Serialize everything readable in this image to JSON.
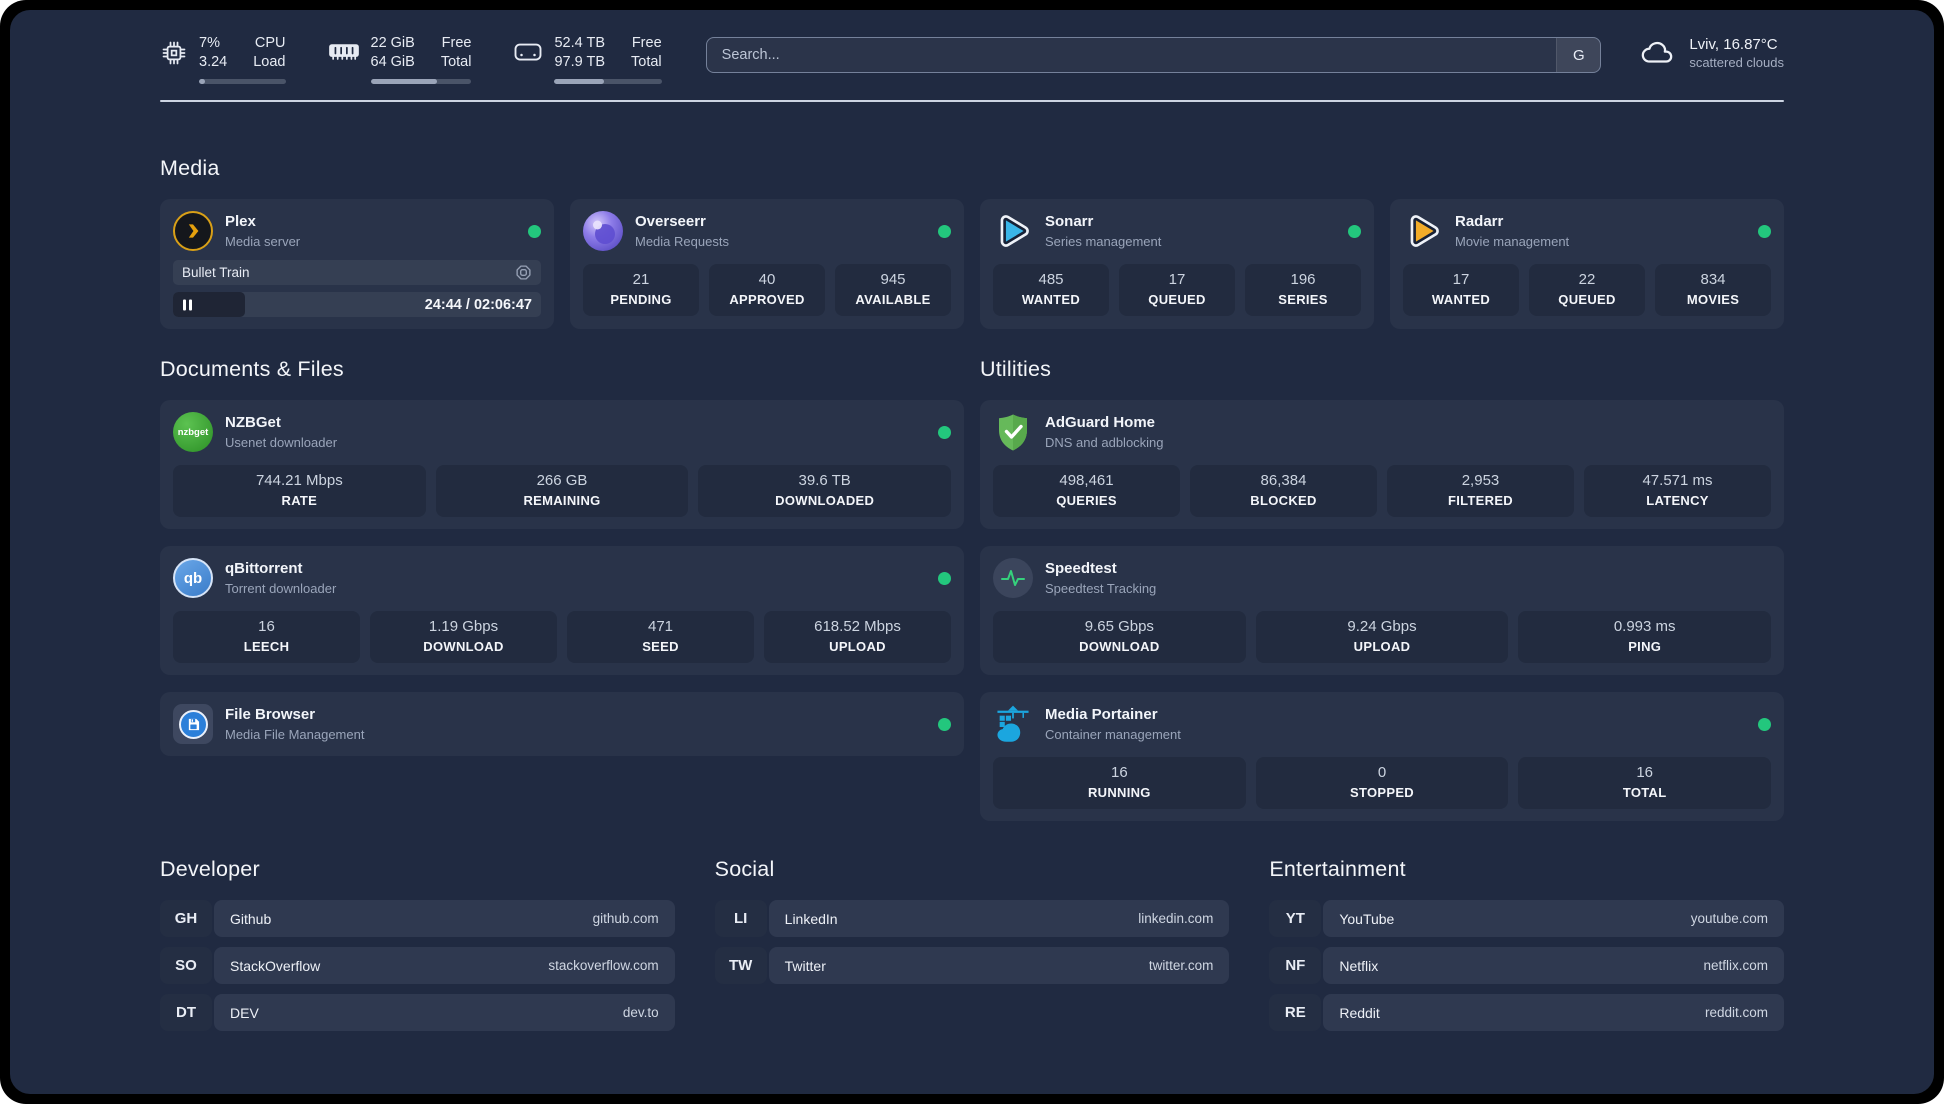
{
  "header": {
    "cpu": {
      "line1_value": "7%",
      "line2_value": "3.24",
      "line1_label": "CPU",
      "line2_label": "Load",
      "progress_pct": 7
    },
    "memory": {
      "line1_value": "22 GiB",
      "line2_value": "64 GiB",
      "line1_label": "Free",
      "line2_label": "Total",
      "progress_pct": 66
    },
    "storage": {
      "line1_value": "52.4 TB",
      "line2_value": "97.9 TB",
      "line1_label": "Free",
      "line2_label": "Total",
      "progress_pct": 46
    },
    "search": {
      "placeholder": "Search...",
      "engine_label": "G"
    },
    "weather": {
      "location_temp": "Lviv, 16.87°C",
      "condition": "scattered clouds"
    }
  },
  "media": {
    "title": "Media",
    "apps": [
      {
        "name": "Plex",
        "subtitle": "Media server",
        "icon": "plex-icon",
        "status": "online",
        "now_playing": {
          "title": "Bullet Train",
          "time": "24:44 / 02:06:47",
          "progress_pct": 19.5
        }
      },
      {
        "name": "Overseerr",
        "subtitle": "Media Requests",
        "icon": "overseerr-icon",
        "status": "online",
        "stats": [
          {
            "value": "21",
            "label": "PENDING"
          },
          {
            "value": "40",
            "label": "APPROVED"
          },
          {
            "value": "945",
            "label": "AVAILABLE"
          }
        ]
      },
      {
        "name": "Sonarr",
        "subtitle": "Series management",
        "icon": "sonarr-icon",
        "status": "online",
        "stats": [
          {
            "value": "485",
            "label": "WANTED"
          },
          {
            "value": "17",
            "label": "QUEUED"
          },
          {
            "value": "196",
            "label": "SERIES"
          }
        ]
      },
      {
        "name": "Radarr",
        "subtitle": "Movie management",
        "icon": "radarr-icon",
        "status": "online",
        "stats": [
          {
            "value": "17",
            "label": "WANTED"
          },
          {
            "value": "22",
            "label": "QUEUED"
          },
          {
            "value": "834",
            "label": "MOVIES"
          }
        ]
      }
    ]
  },
  "documents": {
    "title": "Documents & Files",
    "apps": [
      {
        "name": "NZBGet",
        "subtitle": "Usenet downloader",
        "icon": "nzbget-icon",
        "icon_text": "nzbget",
        "status": "online",
        "stats": [
          {
            "value": "744.21 Mbps",
            "label": "RATE"
          },
          {
            "value": "266 GB",
            "label": "REMAINING"
          },
          {
            "value": "39.6 TB",
            "label": "DOWNLOADED"
          }
        ]
      },
      {
        "name": "qBittorrent",
        "subtitle": "Torrent downloader",
        "icon": "qbittorrent-icon",
        "icon_text": "qb",
        "status": "online",
        "stats": [
          {
            "value": "16",
            "label": "LEECH"
          },
          {
            "value": "1.19 Gbps",
            "label": "DOWNLOAD"
          },
          {
            "value": "471",
            "label": "SEED"
          },
          {
            "value": "618.52 Mbps",
            "label": "UPLOAD"
          }
        ]
      },
      {
        "name": "File Browser",
        "subtitle": "Media File Management",
        "icon": "filebrowser-icon",
        "status": "online",
        "stats": []
      }
    ]
  },
  "utilities": {
    "title": "Utilities",
    "apps": [
      {
        "name": "AdGuard Home",
        "subtitle": "DNS and adblocking",
        "icon": "adguard-icon",
        "stats": [
          {
            "value": "498,461",
            "label": "QUERIES"
          },
          {
            "value": "86,384",
            "label": "BLOCKED"
          },
          {
            "value": "2,953",
            "label": "FILTERED"
          },
          {
            "value": "47.571 ms",
            "label": "LATENCY"
          }
        ]
      },
      {
        "name": "Speedtest",
        "subtitle": "Speedtest Tracking",
        "icon": "speedtest-icon",
        "stats": [
          {
            "value": "9.65 Gbps",
            "label": "DOWNLOAD"
          },
          {
            "value": "9.24 Gbps",
            "label": "UPLOAD"
          },
          {
            "value": "0.993 ms",
            "label": "PING"
          }
        ]
      },
      {
        "name": "Media Portainer",
        "subtitle": "Container management",
        "icon": "portainer-icon",
        "status": "online",
        "stats": [
          {
            "value": "16",
            "label": "RUNNING"
          },
          {
            "value": "0",
            "label": "STOPPED"
          },
          {
            "value": "16",
            "label": "TOTAL"
          }
        ]
      }
    ]
  },
  "links": [
    {
      "title": "Developer",
      "items": [
        {
          "abbr": "GH",
          "name": "Github",
          "url": "github.com"
        },
        {
          "abbr": "SO",
          "name": "StackOverflow",
          "url": "stackoverflow.com"
        },
        {
          "abbr": "DT",
          "name": "DEV",
          "url": "dev.to"
        }
      ]
    },
    {
      "title": "Social",
      "items": [
        {
          "abbr": "LI",
          "name": "LinkedIn",
          "url": "linkedin.com"
        },
        {
          "abbr": "TW",
          "name": "Twitter",
          "url": "twitter.com"
        }
      ]
    },
    {
      "title": "Entertainment",
      "items": [
        {
          "abbr": "YT",
          "name": "YouTube",
          "url": "youtube.com"
        },
        {
          "abbr": "NF",
          "name": "Netflix",
          "url": "netflix.com"
        },
        {
          "abbr": "RE",
          "name": "Reddit",
          "url": "reddit.com"
        }
      ]
    }
  ],
  "colors": {
    "page_background": "#202a41",
    "card_background": "#293349",
    "tile_background": "#222b3f",
    "status_online": "#23c77d",
    "divider": "#ccd4e2",
    "plex": "#e5a00d",
    "overseerr": "#7a69dd",
    "sonarr": "#3ab6e8",
    "radarr": "#f2ac29",
    "nzbget": "#3daa35",
    "qbittorrent": "#4a90d9",
    "filebrowser": "#2b7fd9",
    "adguard": "#66b95a",
    "speedtest_pulse": "#35d17c",
    "portainer": "#1ba6df"
  }
}
